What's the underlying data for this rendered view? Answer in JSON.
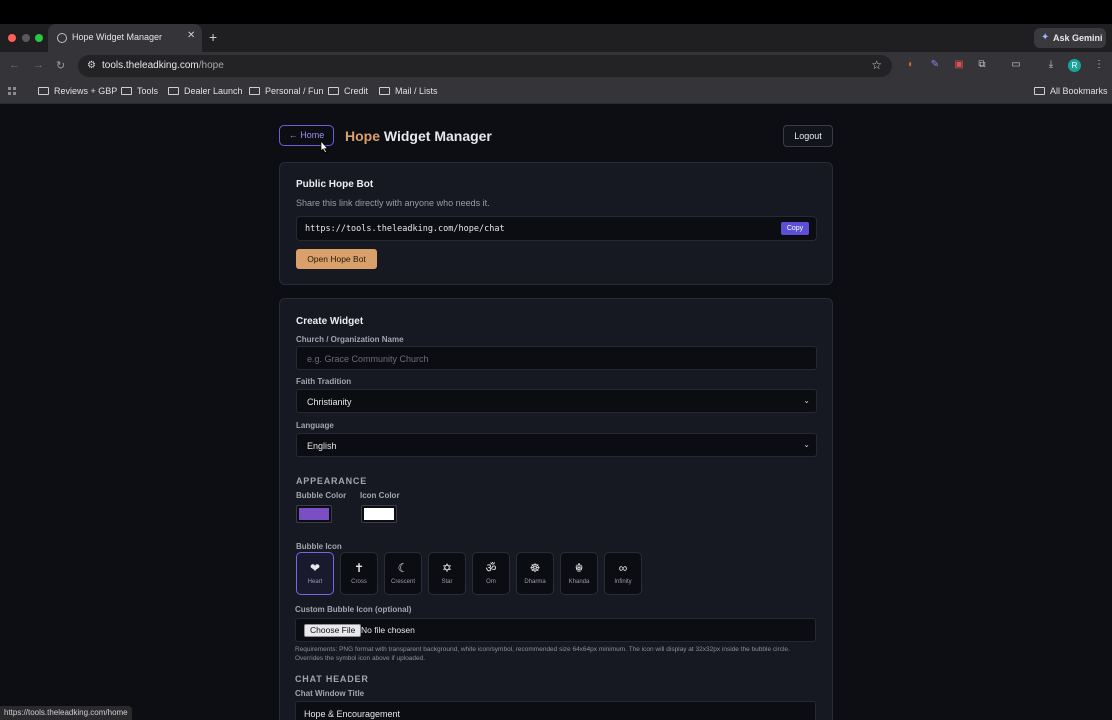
{
  "browser": {
    "tab_title": "Hope Widget Manager",
    "url_host": "tools.theleadking.com",
    "url_path": "/hope",
    "ask_gemini": "Ask Gemini",
    "bookmarks": [
      "Reviews + GBP",
      "Tools",
      "Dealer Launch",
      "Personal / Fun",
      "Credit",
      "Mail / Lists"
    ],
    "all_bookmarks": "All Bookmarks",
    "profile_initial": "R",
    "status_url": "https://tools.theleadking.com/home"
  },
  "header": {
    "home_label": "← Home",
    "title_accent": "Hope",
    "title_rest": "Widget Manager",
    "logout_label": "Logout"
  },
  "public_bot": {
    "heading": "Public Hope Bot",
    "description": "Share this link directly with anyone who needs it.",
    "link": "https://tools.theleadking.com/hope/chat",
    "copy_label": "Copy",
    "open_label": "Open Hope Bot"
  },
  "create_widget": {
    "heading": "Create Widget",
    "org_label": "Church / Organization Name",
    "org_placeholder": "e.g. Grace Community Church",
    "faith_label": "Faith Tradition",
    "faith_value": "Christianity",
    "language_label": "Language",
    "language_value": "English",
    "appearance_heading": "APPEARANCE",
    "bubble_color_label": "Bubble Color",
    "icon_color_label": "Icon Color",
    "bubble_color": "#7b4ec4",
    "icon_color": "#ffffff",
    "bubble_icon_label": "Bubble Icon",
    "icons": [
      {
        "glyph": "❤",
        "name": "Heart"
      },
      {
        "glyph": "✝",
        "name": "Cross"
      },
      {
        "glyph": "☾",
        "name": "Crescent"
      },
      {
        "glyph": "✡",
        "name": "Star"
      },
      {
        "glyph": "ॐ",
        "name": "Om"
      },
      {
        "glyph": "☸",
        "name": "Dharma"
      },
      {
        "glyph": "☬",
        "name": "Khanda"
      },
      {
        "glyph": "∞",
        "name": "Infinity"
      }
    ],
    "selected_icon": "Heart",
    "custom_icon_label": "Custom Bubble Icon (optional)",
    "choose_file_label": "Choose File",
    "no_file_label": "No file chosen",
    "requirements": "Requirements: PNG format with transparent background, white icon/symbol, recommended size 64x64px minimum. The icon will display at 32x32px inside the bubble circle. Overrides the symbol icon above if uploaded.",
    "chat_header_heading": "CHAT HEADER",
    "chat_title_label": "Chat Window Title",
    "chat_title_value": "Hope & Encouragement"
  }
}
